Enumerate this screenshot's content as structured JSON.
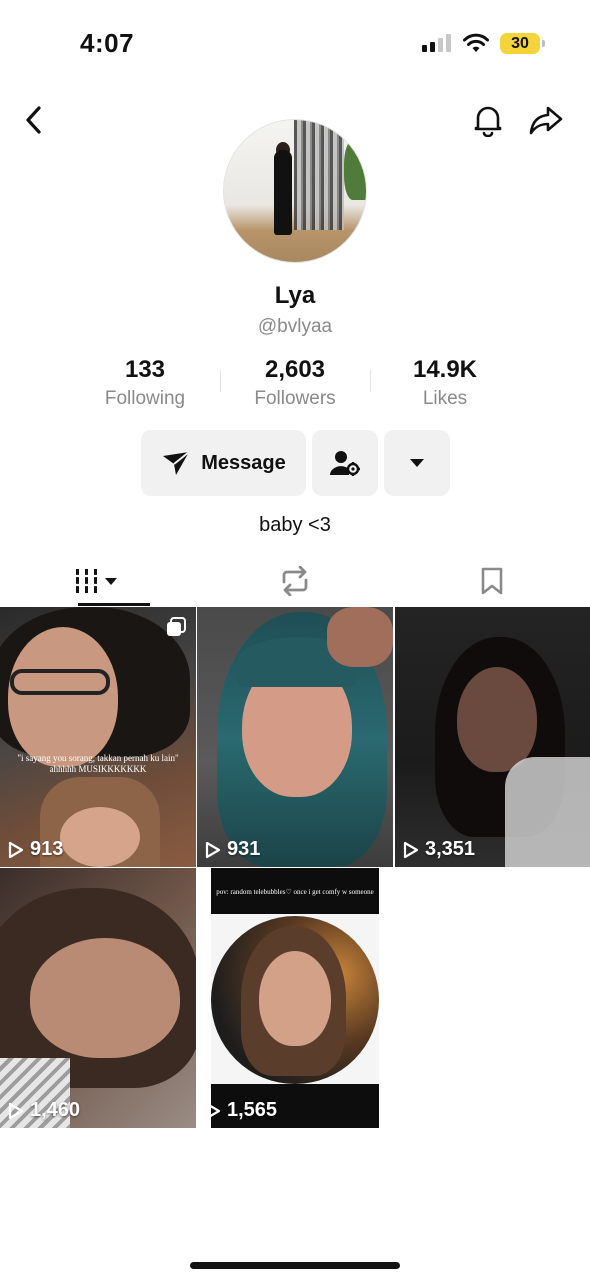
{
  "status_bar": {
    "time": "4:07",
    "battery": "30"
  },
  "profile": {
    "name": "Lya",
    "handle": "@bvlyaa",
    "bio": "baby <3"
  },
  "stats": [
    {
      "value": "133",
      "label": "Following"
    },
    {
      "value": "2,603",
      "label": "Followers"
    },
    {
      "value": "14.9K",
      "label": "Likes"
    }
  ],
  "actions": {
    "message_label": "Message"
  },
  "videos": [
    {
      "views": "913",
      "caption": "\"i sayang you sorang, takkan pernah ku lain\" ahhhhh MUSIKKKKKKK",
      "multi": true
    },
    {
      "views": "931"
    },
    {
      "views": "3,351"
    },
    {
      "views": "1,460"
    },
    {
      "views": "1,565",
      "caption": "pov: random telebubbles♡ once i get comfy w someone"
    }
  ],
  "colors": {
    "accent": "#111111",
    "muted": "#8a8a8a",
    "button_bg": "#f1f1f2",
    "battery": "#f5d33a"
  }
}
